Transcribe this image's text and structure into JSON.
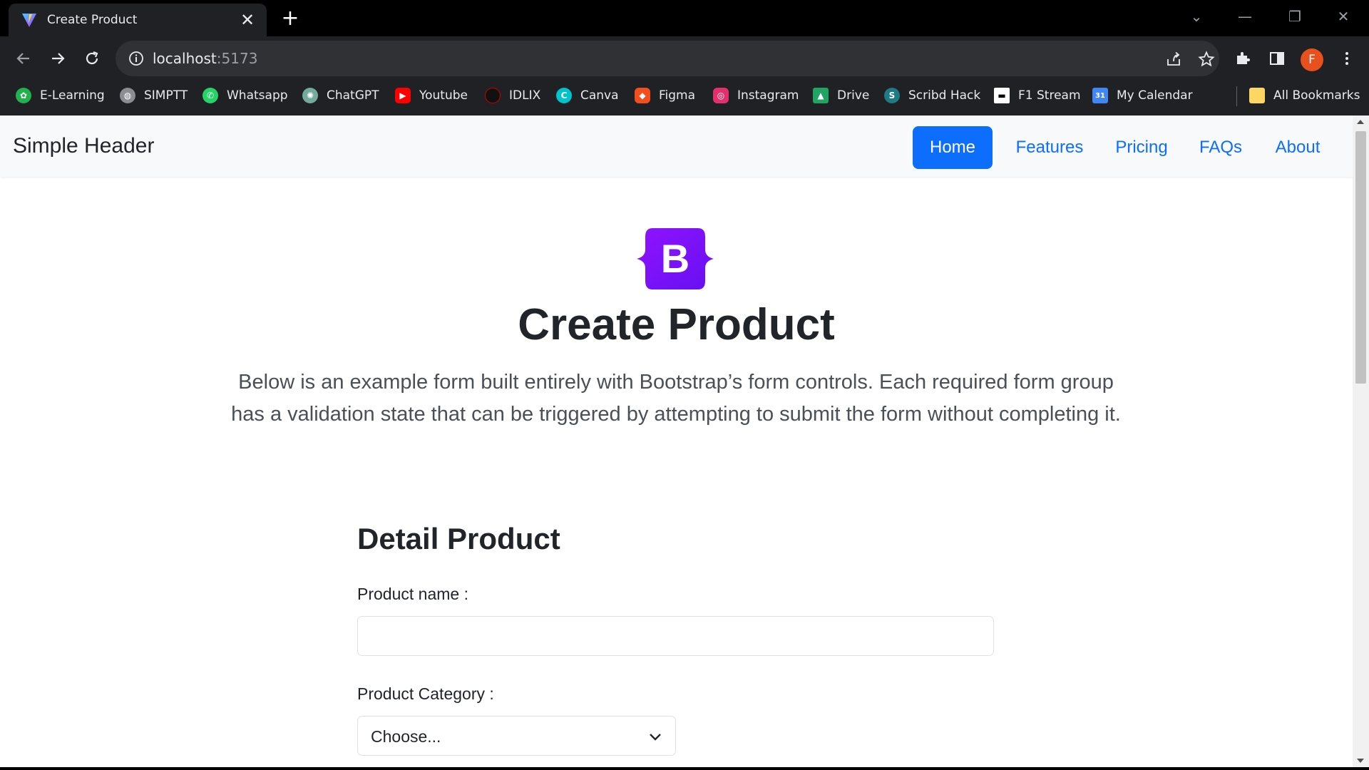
{
  "browser": {
    "tab": {
      "title": "Create Product",
      "favicon": "vite-icon",
      "close": "✕"
    },
    "new_tab": "+",
    "window_controls": {
      "dropdown": "⌄",
      "minimize": "—",
      "restore": "❐",
      "close": "✕"
    },
    "address": {
      "host": "localhost",
      "port": ":5173"
    },
    "profile_initial": "F",
    "bookmarks": [
      {
        "label": "E-Learning",
        "icon": "elearning-icon",
        "color": "#22b14c"
      },
      {
        "label": "SIMPTT",
        "icon": "globe-icon",
        "color": "#8a8d91"
      },
      {
        "label": "Whatsapp",
        "icon": "whatsapp-icon",
        "color": "#25d366"
      },
      {
        "label": "ChatGPT",
        "icon": "chatgpt-icon",
        "color": "#74aa9c"
      },
      {
        "label": "Youtube",
        "icon": "youtube-icon",
        "color": "#ff0000"
      },
      {
        "label": "IDLIX",
        "icon": "idlix-icon",
        "color": "#111111"
      },
      {
        "label": "Canva",
        "icon": "canva-icon",
        "color": "#00c4cc"
      },
      {
        "label": "Figma",
        "icon": "figma-icon",
        "color": "#f24e1e"
      },
      {
        "label": "Instagram",
        "icon": "instagram-icon",
        "color": "#e1306c"
      },
      {
        "label": "Drive",
        "icon": "drive-icon",
        "color": "#1fa463"
      },
      {
        "label": "Scribd Hack",
        "icon": "scribd-icon",
        "color": "#1e7b85"
      },
      {
        "label": "F1 Stream",
        "icon": "f1-icon",
        "color": "#ffffff"
      },
      {
        "label": "My Calendar",
        "icon": "calendar-icon",
        "color": "#4285f4"
      }
    ],
    "all_bookmarks": {
      "label": "All Bookmarks",
      "icon": "folder-icon",
      "color": "#fdd663"
    }
  },
  "navbar": {
    "brand": "Simple Header",
    "links": [
      {
        "label": "Home",
        "active": true
      },
      {
        "label": "Features",
        "active": false
      },
      {
        "label": "Pricing",
        "active": false
      },
      {
        "label": "FAQs",
        "active": false
      },
      {
        "label": "About",
        "active": false
      }
    ]
  },
  "hero": {
    "logo_letter": "B",
    "logo_color": "#7952b3",
    "title": "Create Product",
    "lead": "Below is an example form built entirely with Bootstrap’s form controls. Each required form group has a validation state that can be triggered by attempting to submit the form without completing it."
  },
  "form": {
    "section_title": "Detail Product",
    "product_name_label": "Product name :",
    "product_name_value": "",
    "product_category_label": "Product Category :",
    "product_category_value": "Choose..."
  },
  "colors": {
    "primary": "#0d6efd",
    "chrome_dark": "#202124",
    "navbar_bg": "#f8f9fa"
  }
}
